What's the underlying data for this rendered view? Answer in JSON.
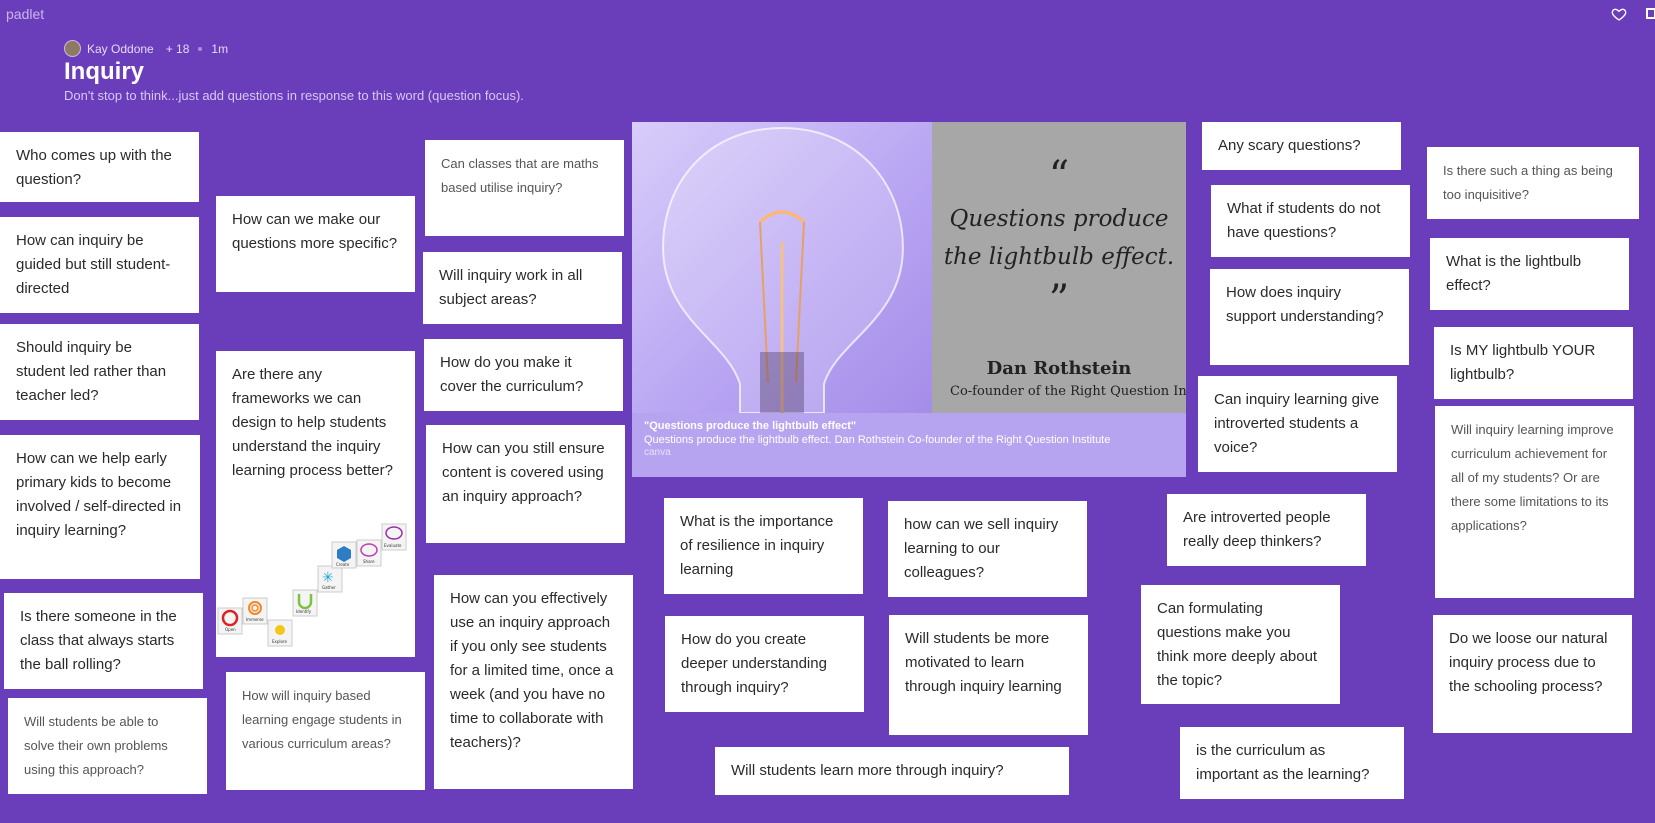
{
  "app": {
    "logo": "padlet"
  },
  "header": {
    "author": "Kay Oddone",
    "contributors": "+ 18",
    "time": "1m",
    "title": "Inquiry",
    "subtitle": "Don't stop to think...just add questions in response to this word (question focus)."
  },
  "colors": {
    "background": "#6a3dbb",
    "card": "#ffffff"
  },
  "hero": {
    "quote_open": "“",
    "quote_line1": "Questions produce",
    "quote_line2": "the lightbulb effect.",
    "quote_close": "”",
    "author": "Dan Rothstein",
    "role": "Co-founder of the Right Question Institute",
    "caption_title": "\"Questions produce the lightbulb effect\"",
    "caption_text": "Questions produce the lightbulb effect. Dan Rothstein Co-founder of the Right Question Institute",
    "caption_source": "canva"
  },
  "posts": [
    "Who comes up with the question?",
    "How can inquiry be guided but still student-directed",
    "Should inquiry be student led rather than teacher led?",
    "How can we help early primary kids to become involved / self-directed in inquiry learning?",
    "Is there someone in the class that always starts the ball rolling?",
    "Will students be able to solve their own problems using this approach?",
    "How can we make our questions more specific?",
    "Are there any frameworks we can design to help students understand the inquiry learning process better?",
    "How will inquiry based learning engage students in various curriculum areas?",
    "Can classes that are maths based utilise inquiry?",
    "Will inquiry work in all subject areas?",
    "How do you make it cover the curriculum?",
    "How can you still ensure content is covered using an inquiry approach?",
    "How can you effectively use an inquiry approach if you only see students for a limited time, once a week (and you have no time to collaborate with teachers)?",
    "What is the importance of resilience in inquiry learning",
    "How do you create deeper understanding through inquiry?",
    "how can we sell inquiry learning to our colleagues?",
    "Will students be more motivated to learn through inquiry learning",
    "Will students learn more through inquiry?",
    "Any scary questions?",
    "What if students do not have questions?",
    "How does inquiry support understanding?",
    "Can inquiry learning give introverted students a voice?",
    "Are introverted people really deep thinkers?",
    "Can formulating questions make you think more deeply about the topic?",
    "is the curriculum as important as the learning?",
    "Is there such a thing as being too inquisitive?",
    "What is the lightbulb effect?",
    "Is MY lightbulb YOUR lightbulb?",
    "Will inquiry learning improve curriculum achievement for all of my students? Or are there some limitations to its applications?",
    "Do we loose our natural inquiry process due to the schooling process?"
  ],
  "frameworks_image": {
    "labels": [
      "Open",
      "Immerse",
      "Explore",
      "Identify",
      "Gather",
      "Create",
      "Share",
      "Evaluate"
    ]
  }
}
